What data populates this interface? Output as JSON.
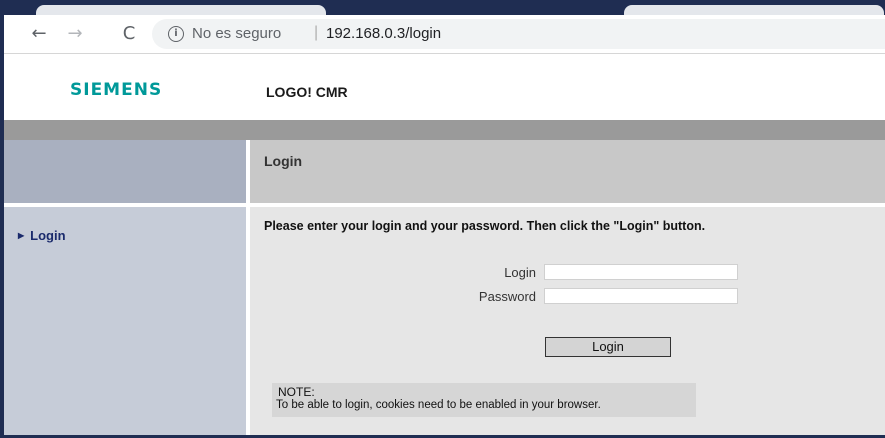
{
  "browser": {
    "security_text": "No es seguro",
    "separator": "|",
    "url": "192.168.0.3/login",
    "back_glyph": "←",
    "forward_glyph": "→",
    "reload_glyph": "C",
    "info_glyph": "i"
  },
  "header": {
    "brand": "SIEMENS",
    "product": "LOGO! CMR",
    "brand_color": "#009999"
  },
  "sidebar": {
    "items": [
      {
        "label": "Login",
        "marker": "▶"
      }
    ]
  },
  "main": {
    "page_title": "Login",
    "instruction": "Please enter your login and your password. Then click the \"Login\" button.",
    "login_label": "Login",
    "login_value": "",
    "password_label": "Password",
    "password_value": "",
    "login_button": "Login",
    "note_title": "NOTE:",
    "note_text": "To be able to login, cookies need to be enabled in your browser."
  }
}
